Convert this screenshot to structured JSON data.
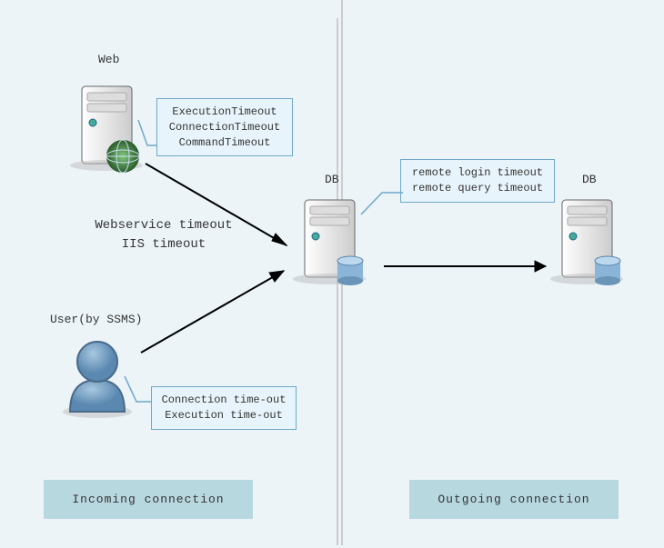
{
  "nodes": {
    "web": {
      "label": "Web"
    },
    "db1": {
      "label": "DB"
    },
    "db2": {
      "label": "DB"
    },
    "user": {
      "label": "User(by SSMS)"
    }
  },
  "boxes": {
    "web_timeouts": {
      "line1": "ExecutionTimeout",
      "line2": "ConnectionTimeout",
      "line3": "CommandTimeout"
    },
    "db_timeouts": {
      "line1": "remote login timeout",
      "line2": "remote query timeout"
    },
    "user_timeouts": {
      "line1": "Connection time-out",
      "line2": "Execution time-out"
    }
  },
  "mid_text": {
    "line1": "Webservice timeout",
    "line2": "IIS timeout"
  },
  "footer": {
    "incoming": "Incoming connection",
    "outgoing": "Outgoing connection"
  }
}
